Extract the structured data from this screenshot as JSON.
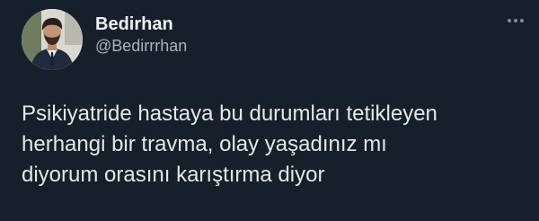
{
  "author": {
    "display_name": "Bedirhan",
    "handle": "@Bedirrrhan",
    "avatar_icon": "profile-photo"
  },
  "menu": {
    "icon": "more-options-icon"
  },
  "tweet": {
    "lines": [
      "Psikiyatride hastaya bu durumları tetikleyen",
      "herhangi bir travma, olay yaşadınız mı",
      "diyorum orasını karıştırma diyor"
    ]
  },
  "colors": {
    "background": "#15202b",
    "primary_text": "#e6e6e6",
    "secondary_text": "#aab2ba"
  }
}
